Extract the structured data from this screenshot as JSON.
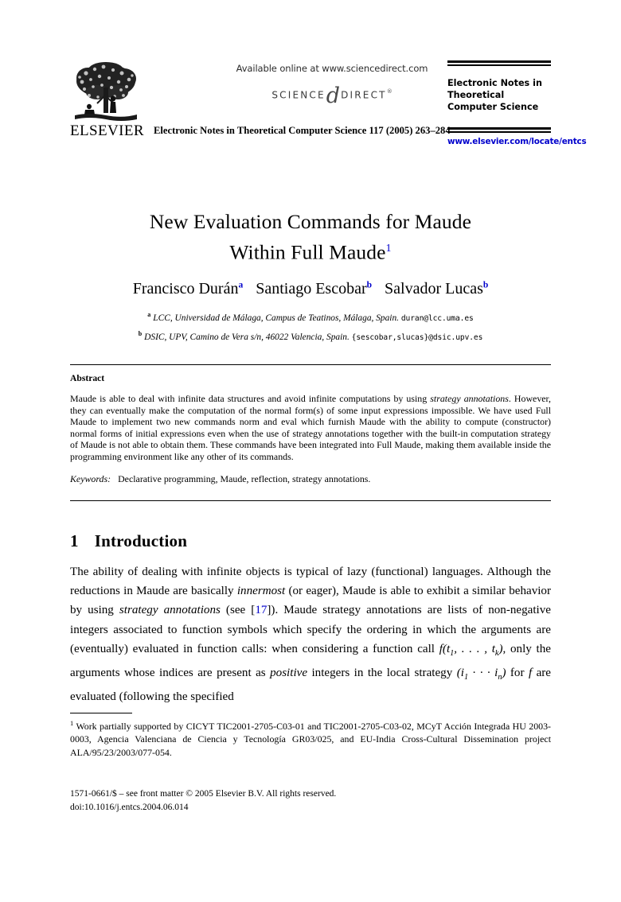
{
  "masthead": {
    "publisher_wordmark": "ELSEVIER",
    "available_online": "Available online at www.sciencedirect.com",
    "sciencedirect": {
      "left_word": "SCIENCE",
      "glyph": "d",
      "right_word": "DIRECT",
      "trademark": "®"
    },
    "journal_name": "Electronic Notes in Theoretical Computer Science",
    "citation_line": "Electronic Notes in Theoretical Computer Science 117 (2005) 263–284",
    "journal_url": "www.elsevier.com/locate/entcs"
  },
  "title": {
    "line1": "New Evaluation Commands for Maude",
    "line2": "Within Full Maude",
    "footnote_marker": "1"
  },
  "authors": [
    {
      "name": "Francisco Durán",
      "affiliation_marker": "a"
    },
    {
      "name": "Santiago Escobar",
      "affiliation_marker": "b"
    },
    {
      "name": "Salvador Lucas",
      "affiliation_marker": "b"
    }
  ],
  "affiliations": [
    {
      "marker": "a",
      "text": "LCC, Universidad de Málaga, Campus de Teatinos, Málaga, Spain.",
      "email": "duran@lcc.uma.es"
    },
    {
      "marker": "b",
      "text": "DSIC, UPV, Camino de Vera s/n, 46022 Valencia, Spain.",
      "email": "{sescobar,slucas}@dsic.upv.es"
    }
  ],
  "abstract": {
    "heading": "Abstract",
    "p1_a": "Maude is able to deal with infinite data structures and avoid infinite computations by using ",
    "p1_em1": "strategy annotations",
    "p1_b": ". However, they can eventually make the computation of the normal form(s) of some input expressions impossible. We have used Full Maude to implement two new commands norm and eval which furnish Maude with the ability to compute (constructor) normal forms of initial expressions even when the use of strategy annotations together with the built-in computation strategy of Maude is not able to obtain them. These commands have been integrated into Full Maude, making them available inside the programming environment like any other of its commands."
  },
  "keywords": {
    "label": "Keywords:",
    "value": "Declarative programming, Maude, reflection, strategy annotations."
  },
  "section": {
    "number": "1",
    "title": "Introduction"
  },
  "intro": {
    "t1": "The ability of dealing with infinite objects is typical of lazy (functional) languages. Although the reductions in Maude are basically ",
    "em1": "innermost",
    "t2": " (or eager), Maude is able to exhibit a similar behavior by using ",
    "em2": "strategy annotations",
    "t3": " (see [",
    "cite1": "17",
    "t4": "]). Maude strategy annotations are lists of non-negative integers associated to function symbols which specify the ordering in which the arguments are (eventually) evaluated in function calls: when considering a function call ",
    "math1_f": "f",
    "math1_open": "(",
    "math1_t1": "t",
    "math1_t1sub": "1",
    "math1_dots": ", . . . , ",
    "math1_tk": "t",
    "math1_tksub": "k",
    "math1_close": ")",
    "t5": ", only the arguments whose indices are present as ",
    "em3": "positive",
    "t6": " integers in the local strategy ",
    "math2_open": "(",
    "math2_i1": "i",
    "math2_i1sub": "1",
    "math2_cdots": " · · · ",
    "math2_in": "i",
    "math2_insub": "n",
    "math2_close": ")",
    "t7": " for ",
    "math3_f": "f",
    "t8": " are evaluated (following the specified"
  },
  "footnote": {
    "marker": "1",
    "text": "Work partially supported by CICYT TIC2001-2705-C03-01 and TIC2001-2705-C03-02, MCyT Acción Integrada HU 2003-0003, Agencia Valenciana de Ciencia y Tecnología GR03/025, and EU-India Cross-Cultural Dissemination project ALA/95/23/2003/077-054."
  },
  "footer": {
    "line1": "1571-0661/$ – see front matter © 2005 Elsevier B.V. All rights reserved.",
    "line2": "doi:10.1016/j.entcs.2004.06.014"
  },
  "colors": {
    "link": "#0000cc",
    "text": "#000000",
    "background": "#ffffff"
  }
}
